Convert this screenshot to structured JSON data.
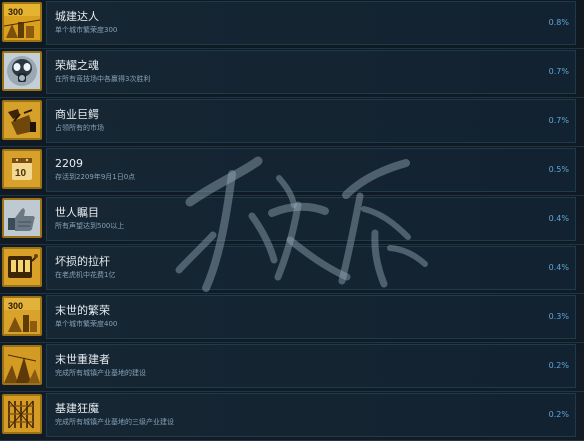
{
  "achievements": [
    {
      "icon_name": "city-300-icon",
      "title": "城建达人",
      "description": "单个城市繁荣度300",
      "percent": "0.8%"
    },
    {
      "icon_name": "gas-mask-icon",
      "title": "荣耀之魂",
      "description": "在所有竞技场中各赢得3次胜利",
      "percent": "0.7%"
    },
    {
      "icon_name": "tycoon-icon",
      "title": "商业巨鳄",
      "description": "占领所有的市场",
      "percent": "0.7%"
    },
    {
      "icon_name": "calendar-icon",
      "title": "2209",
      "description": "存活到2209年9月1日0点",
      "percent": "0.5%"
    },
    {
      "icon_name": "thumbs-up-icon",
      "title": "世人瞩目",
      "description": "所有声望达到500以上",
      "percent": "0.4%"
    },
    {
      "icon_name": "slot-machine-icon",
      "title": "坏损的拉杆",
      "description": "在老虎机中花费1亿",
      "percent": "0.4%"
    },
    {
      "icon_name": "city-400-icon",
      "title": "末世的繁荣",
      "description": "单个城市繁荣度400",
      "percent": "0.3%"
    },
    {
      "icon_name": "industry-base-icon",
      "title": "末世重建者",
      "description": "完成所有城镇产业基地的建设",
      "percent": "0.2%"
    },
    {
      "icon_name": "construction-icon",
      "title": "基建狂魔",
      "description": "完成所有城镇产业基地的三级产业建设",
      "percent": "0.2%"
    }
  ],
  "colors": {
    "background": "#101a24",
    "panel": "#142431",
    "icon_gold": "#d9a11e",
    "percent": "#5fa6d9"
  }
}
